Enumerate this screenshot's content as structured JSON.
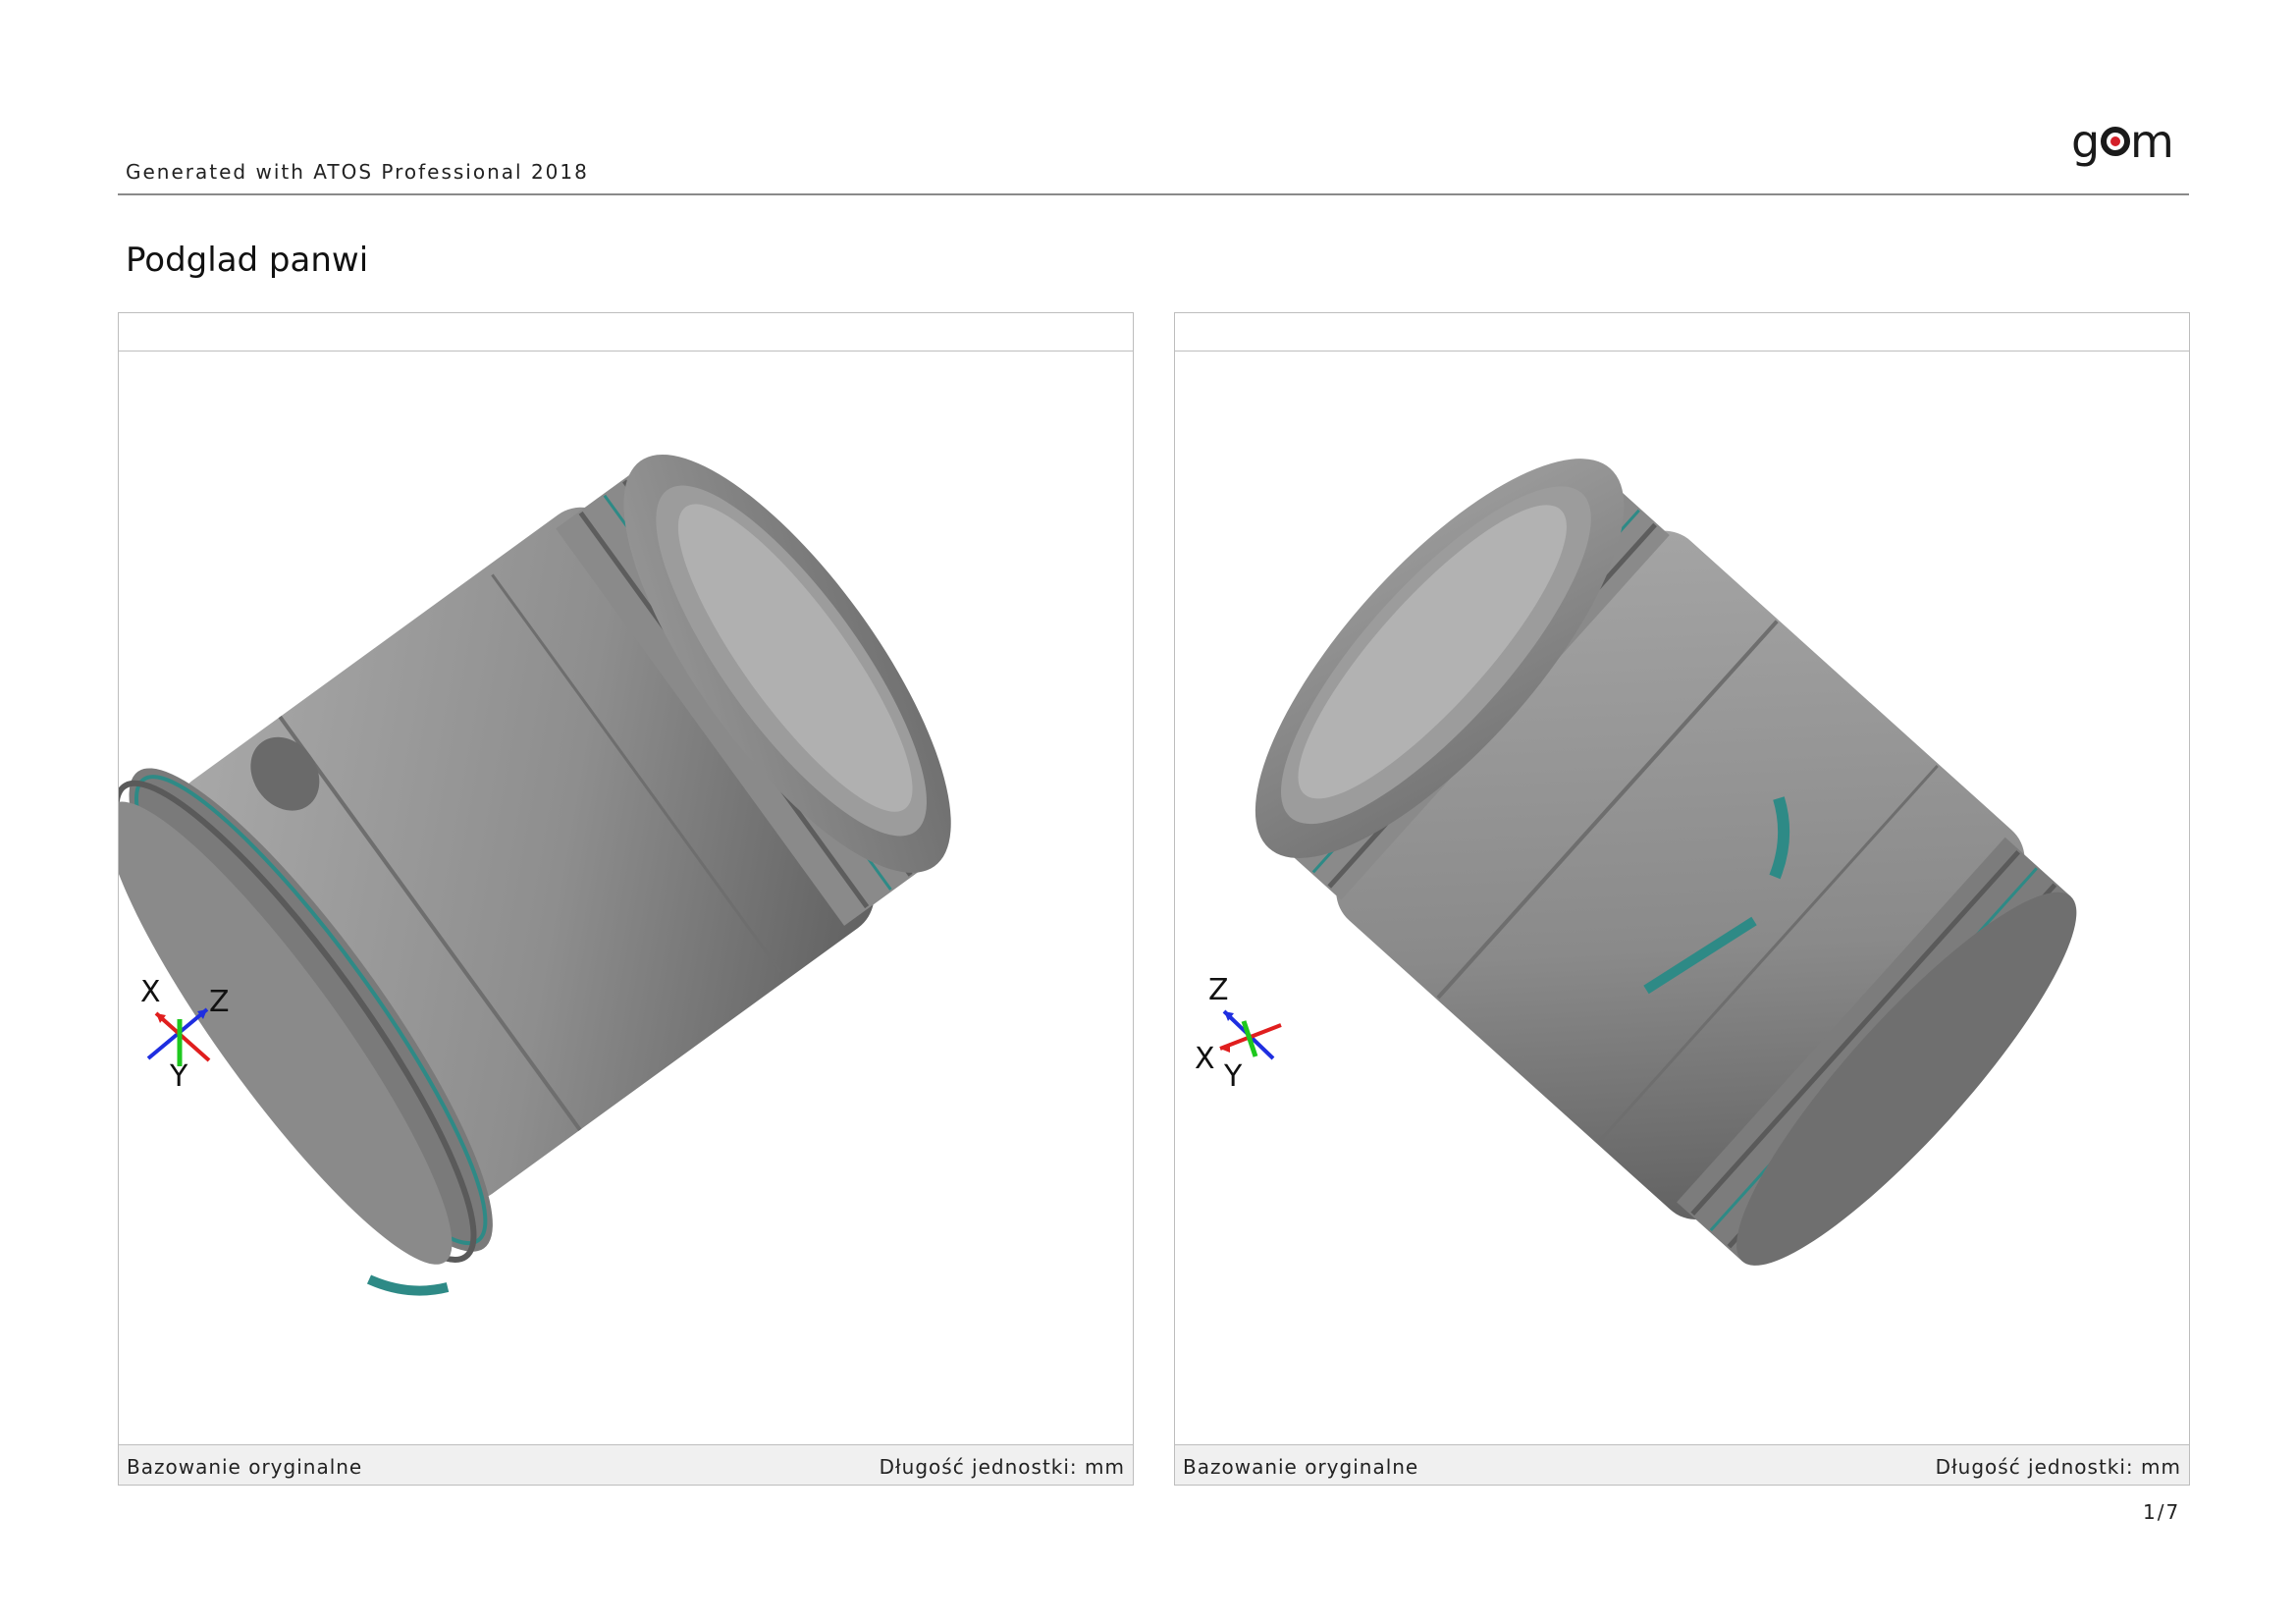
{
  "header": {
    "generated_text": "Generated with ATOS Professional 2018",
    "logo_text": "gom",
    "logo_colors": {
      "letters": "#1a1a1a",
      "dot": "#d4202a"
    }
  },
  "title": "Podglad panwi",
  "panels": [
    {
      "footer_left": "Bazowanie oryginalne",
      "footer_right": "Długość jednostki: mm",
      "axes": {
        "x": "X",
        "y": "Y",
        "z": "Z"
      }
    },
    {
      "footer_left": "Bazowanie oryginalne",
      "footer_right": "Długość jednostki: mm",
      "axes": {
        "x": "X",
        "y": "Y",
        "z": "Z"
      }
    }
  ],
  "page_number": "1/7",
  "colors": {
    "part_gray": "#8c8c8c",
    "part_highlight": "#b3b3b3",
    "deviation_teal": "#2e8a86",
    "axis_x": "#e01e1e",
    "axis_y": "#1ec81e",
    "axis_z": "#1e2ee0"
  }
}
